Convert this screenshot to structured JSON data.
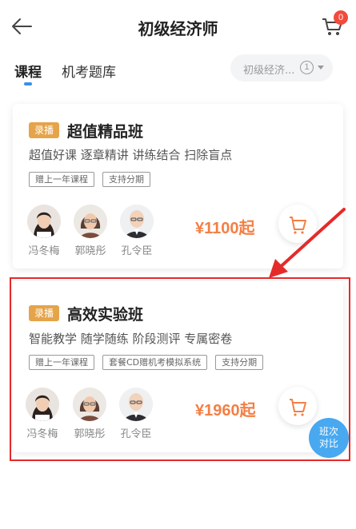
{
  "header": {
    "title": "初级经济师",
    "cart_count": "0"
  },
  "tabs": [
    {
      "label": "课程",
      "active": true
    },
    {
      "label": "机考题库",
      "active": false
    }
  ],
  "exam_selector": {
    "label": "初级经济...",
    "count": "1"
  },
  "courses": [
    {
      "badge": "录播",
      "name": "超值精品班",
      "desc": "超值好课 逐章精讲 讲练结合 扫除盲点",
      "tags": [
        "赠上一年课程",
        "支持分期"
      ],
      "teachers": [
        "冯冬梅",
        "郭晓彤",
        "孔令臣"
      ],
      "price": "¥1100起"
    },
    {
      "badge": "录播",
      "name": "高效实验班",
      "desc": "智能教学 随学随练 阶段测评 专属密卷",
      "tags": [
        "赠上一年课程",
        "套餐CD赠机考模拟系统",
        "支持分期"
      ],
      "teachers": [
        "冯冬梅",
        "郭晓彤",
        "孔令臣"
      ],
      "price": "¥1960起"
    }
  ],
  "compare_button": {
    "line1": "班次",
    "line2": "对比"
  },
  "colors": {
    "accent": "#3a8ef0",
    "price": "#f37f45",
    "badge": "#e5a44a",
    "highlight": "#e52a2a",
    "compare": "#48a8f0"
  }
}
